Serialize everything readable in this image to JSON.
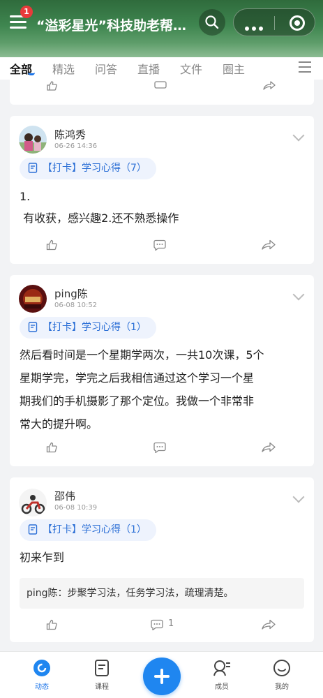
{
  "header": {
    "notification_count": "1",
    "title": "“溢彩星光”科技助老帮扶活动"
  },
  "tabs": [
    {
      "label": "全部"
    },
    {
      "label": "精选"
    },
    {
      "label": "问答"
    },
    {
      "label": "直播"
    },
    {
      "label": "文件"
    },
    {
      "label": "圈主"
    }
  ],
  "posts": [
    {
      "author": "陈鸿秀",
      "time": "06-26 14:36",
      "tag": "【打卡】学习心得（7）",
      "content_lines": [
        "1.",
        " 有收获，感兴趣2.还不熟悉操作"
      ],
      "comment_count": ""
    },
    {
      "author": "ping陈",
      "time": "06-08 10:52",
      "tag": "【打卡】学习心得（1）",
      "content_lines": [
        "然后看时间是一个星期学两次，一共10次课，5个",
        "星期学完，学完之后我相信通过这个学习一个星",
        "期我们的手机摄影了那个定位。我做一个非常非",
        "常大的提升啊。"
      ],
      "comment_count": ""
    },
    {
      "author": "邵伟",
      "time": "06-08 10:39",
      "tag": "【打卡】学习心得（1）",
      "content_lines": [
        "初来乍到"
      ],
      "comment_preview": "ping陈：步聚学习法，任务学习法，疏理清楚。",
      "comment_count": "1"
    }
  ],
  "bottom_nav": [
    {
      "label": "动态",
      "icon": "activity-icon"
    },
    {
      "label": "课程",
      "icon": "course-icon"
    },
    {
      "label": "",
      "icon": "plus-icon"
    },
    {
      "label": "成员",
      "icon": "members-icon"
    },
    {
      "label": "我的",
      "icon": "profile-icon"
    }
  ],
  "colors": {
    "accent": "#1f86f0",
    "tag_bg": "#eef3fd",
    "tag_text": "#2b6fd6"
  }
}
